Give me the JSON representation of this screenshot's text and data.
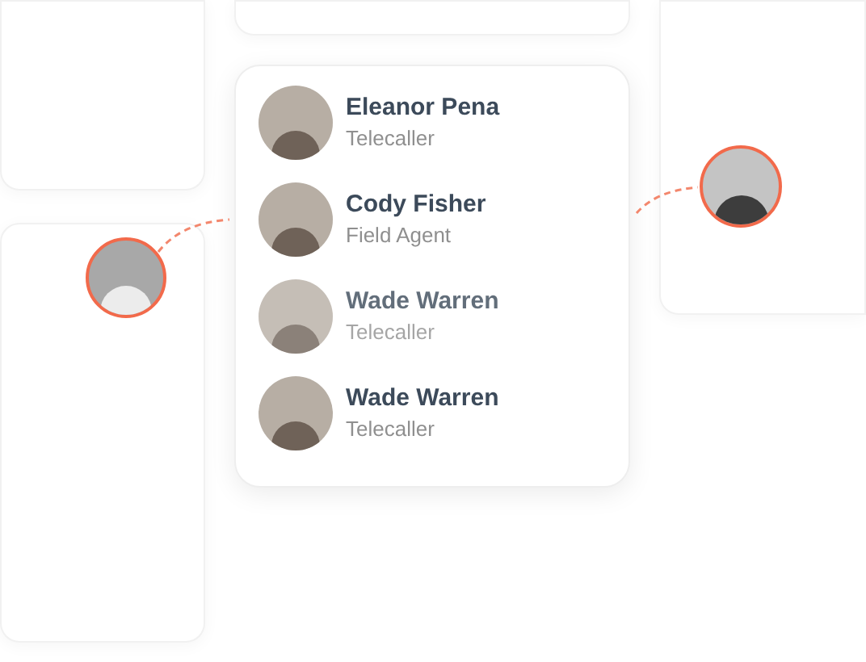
{
  "people": [
    {
      "name": "Eleanor Pena",
      "role": "Telecaller",
      "faded": false
    },
    {
      "name": "Cody Fisher",
      "role": "Field Agent",
      "faded": false
    },
    {
      "name": "Wade Warren",
      "role": "Telecaller",
      "faded": true
    },
    {
      "name": "Wade Warren",
      "role": "Telecaller",
      "faded": false
    }
  ]
}
